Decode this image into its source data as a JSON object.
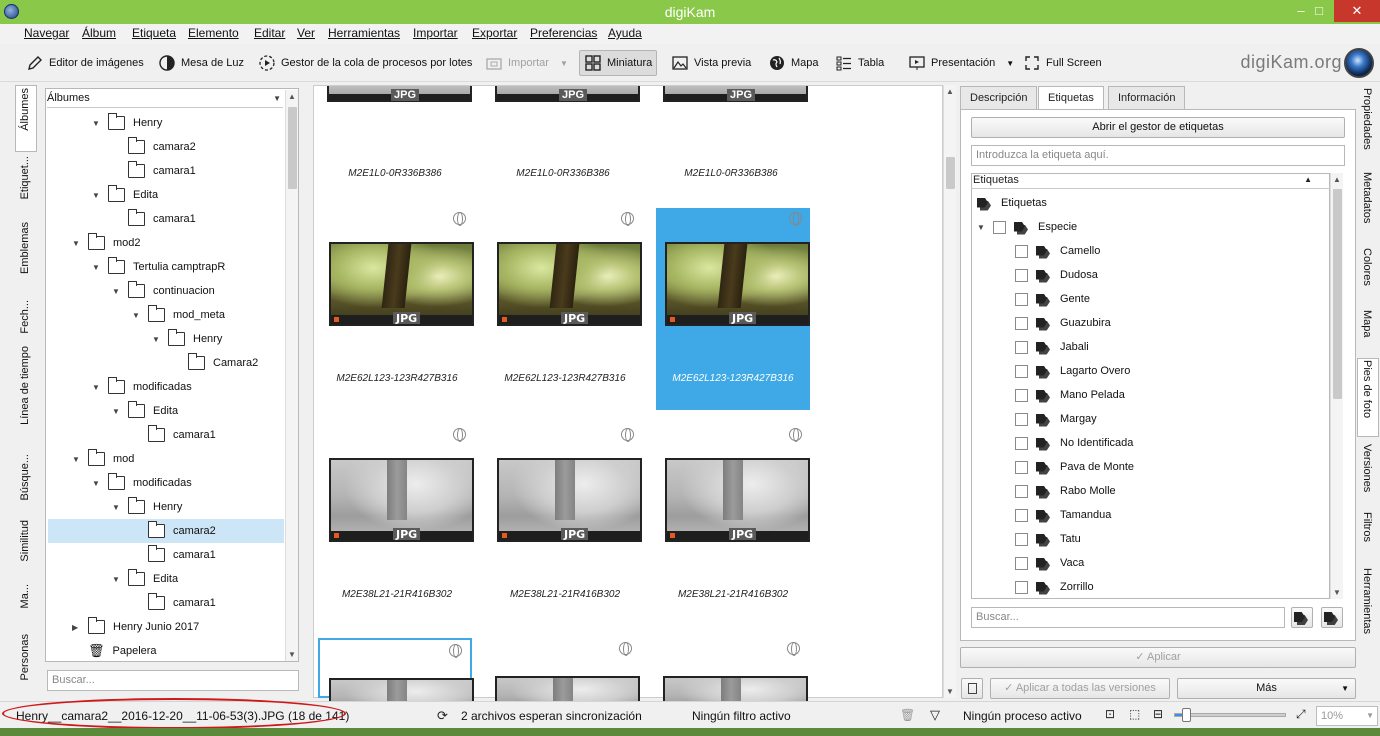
{
  "window": {
    "title": "digiKam",
    "minimize": "–",
    "maximize": "□",
    "close": "✕"
  },
  "menu": [
    "Navegar",
    "Álbum",
    "Etiqueta",
    "Elemento",
    "Editar",
    "Ver",
    "Herramientas",
    "Importar",
    "Exportar",
    "Preferencias",
    "Ayuda"
  ],
  "toolbar": {
    "image_editor": "Editor de imágenes",
    "light_table": "Mesa de Luz",
    "batch_queue": "Gestor de la cola de procesos por lotes",
    "import": "Importar",
    "thumbnails": "Miniatura",
    "preview": "Vista previa",
    "map": "Mapa",
    "table": "Tabla",
    "slideshow": "Presentación",
    "fullscreen": "Full Screen",
    "brand": "digiKam.org"
  },
  "left_sidebar_tabs": [
    "Álbumes",
    "Etiquet...",
    "Emblemas",
    "Fech...",
    "Línea de tiempo",
    "Búsque...",
    "Similitud",
    "Ma...",
    "Personas"
  ],
  "albums": {
    "header": "Álbumes",
    "tree": [
      {
        "label": "Henry",
        "depth": 2,
        "expanded": true
      },
      {
        "label": "camara2",
        "depth": 3
      },
      {
        "label": "camara1",
        "depth": 3
      },
      {
        "label": "Edita",
        "depth": 2,
        "expanded": true
      },
      {
        "label": "camara1",
        "depth": 3
      },
      {
        "label": "mod2",
        "depth": 1,
        "expanded": true
      },
      {
        "label": "Tertulia camptrapR",
        "depth": 2,
        "expanded": true
      },
      {
        "label": "continuacion",
        "depth": 3,
        "expanded": true
      },
      {
        "label": "mod_meta",
        "depth": 4,
        "expanded": true
      },
      {
        "label": "Henry",
        "depth": 5,
        "expanded": true
      },
      {
        "label": "Camara2",
        "depth": 6
      },
      {
        "label": "modificadas",
        "depth": 2,
        "expanded": true
      },
      {
        "label": "Edita",
        "depth": 3,
        "expanded": true
      },
      {
        "label": "camara1",
        "depth": 4
      },
      {
        "label": "mod",
        "depth": 1,
        "expanded": true
      },
      {
        "label": "modificadas",
        "depth": 2,
        "expanded": true
      },
      {
        "label": "Henry",
        "depth": 3,
        "expanded": true
      },
      {
        "label": "camara2",
        "depth": 4,
        "selected": true
      },
      {
        "label": "camara1",
        "depth": 4
      },
      {
        "label": "Edita",
        "depth": 3,
        "expanded": true
      },
      {
        "label": "camara1",
        "depth": 4
      },
      {
        "label": "Henry Junio 2017",
        "depth": 1,
        "expanded": false
      },
      {
        "label": "Papelera",
        "depth": 1,
        "trash": true
      }
    ],
    "search_placeholder": "Buscar..."
  },
  "thumbnails": {
    "top_row_captions": [
      "M2E1L0-0R336B386",
      "M2E1L0-0R336B386",
      "M2E1L0-0R336B386"
    ],
    "rows": [
      {
        "caption": "M2E62L123-123R427B316",
        "style": "forest",
        "items": 3,
        "selected_index": 2
      },
      {
        "caption": "M2E38L21-21R416B302",
        "style": "gray",
        "items": 3
      }
    ],
    "badge": "JPG"
  },
  "right_panel": {
    "tabs": [
      "Descripción",
      "Etiquetas",
      "Información"
    ],
    "active_tab": "Etiquetas",
    "open_tag_manager": "Abrir el gestor de etiquetas",
    "tag_input_placeholder": "Introduzca la etiqueta aquí.",
    "tree_header": "Etiquetas",
    "root": "Etiquetas",
    "group": "Especie",
    "tags": [
      "Camello",
      "Dudosa",
      "Gente",
      "Guazubira",
      "Jabali",
      "Lagarto Overo",
      "Mano Pelada",
      "Margay",
      "No Identificada",
      "Pava de Monte",
      "Rabo Molle",
      "Tamandua",
      "Tatu",
      "Vaca",
      "Zorrillo"
    ],
    "search_placeholder": "Buscar...",
    "apply": "✓ Aplicar",
    "apply_all": "✓ Aplicar a todas las versiones",
    "more": "Más"
  },
  "right_sidebar_tabs": [
    "Propiedades",
    "Metadatos",
    "Colores",
    "Mapa",
    "Pies de foto",
    "Versiones",
    "Filtros",
    "Herramientas"
  ],
  "status": {
    "file": "Henry__camara2__2016-12-20__11-06-53(3).JPG (18 de 141)",
    "sync": "2 archivos esperan sincronización",
    "filter": "Ningún filtro activo",
    "process": "Ningún proceso activo",
    "zoom": "10%",
    "zoom_value": 0.1
  },
  "colors": {
    "titlebar": "#8ac84a",
    "selection": "#3fa8e6",
    "tree_selection": "#cde6f7",
    "annotation": "#d01818"
  }
}
